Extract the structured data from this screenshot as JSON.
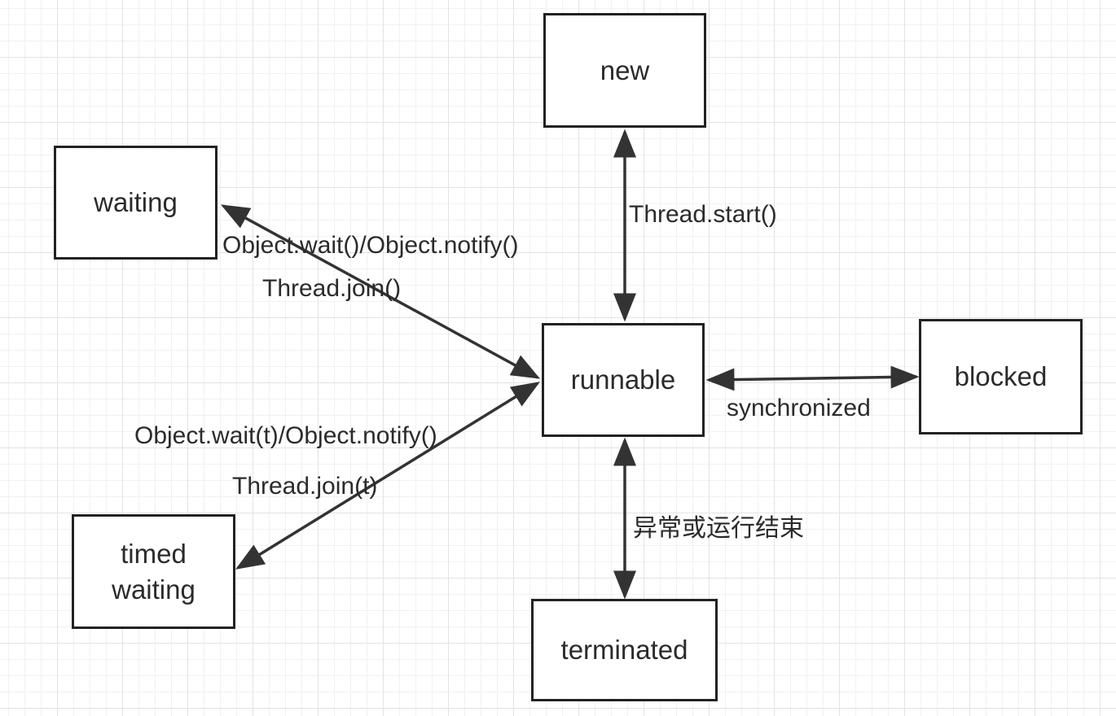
{
  "diagram": {
    "nodes": {
      "new": "new",
      "waiting": "waiting",
      "runnable": "runnable",
      "blocked": "blocked",
      "timed_waiting_line1": "timed",
      "timed_waiting_line2": "waiting",
      "terminated": "terminated"
    },
    "edges": {
      "new_runnable": "Thread.start()",
      "runnable_blocked": "synchronized",
      "runnable_terminated": "异常或运行结束",
      "waiting_runnable_1": "Object.wait()/Object.notify()",
      "waiting_runnable_2": "Thread.join()",
      "timed_waiting_runnable_1": "Object.wait(t)/Object.notify()",
      "timed_waiting_runnable_2": "Thread.join(t)"
    }
  }
}
